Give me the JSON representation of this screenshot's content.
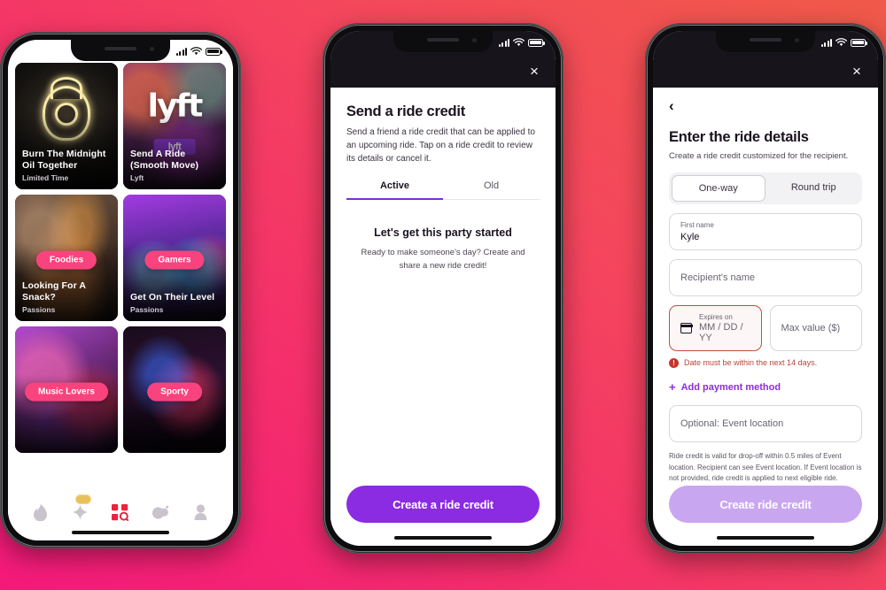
{
  "theme": {
    "bg_gradient_from": "#F3197A",
    "bg_gradient_to": "#F05A48",
    "accent_purple": "#8B2BE2",
    "accent_purple_disabled": "#C9A6F0",
    "accent_pink": "#F9437E",
    "error_red": "#C8332B"
  },
  "phone_left": {
    "name": "discover-grid-screen",
    "status_bar": {
      "signal": "signal-bars-icon",
      "wifi": "wifi-icon",
      "battery": "battery-icon"
    },
    "cards": [
      {
        "title": "Burn The Midnight Oil Together",
        "subtitle": "Limited Time",
        "badge": "",
        "art": "owl"
      },
      {
        "title": "Send A Ride (Smooth Move)",
        "subtitle": "Lyft",
        "badge": "",
        "art": "lyft"
      },
      {
        "title": "Looking For A Snack?",
        "subtitle": "Passions",
        "badge": "Foodies",
        "art": "food"
      },
      {
        "title": "Get On Their Level",
        "subtitle": "Passions",
        "badge": "Gamers",
        "art": "game"
      },
      {
        "title": "",
        "subtitle": "",
        "badge": "Music Lovers",
        "art": "music"
      },
      {
        "title": "",
        "subtitle": "",
        "badge": "Sporty",
        "art": "sport"
      }
    ],
    "tabs": [
      {
        "name": "flame-icon",
        "label": "Home",
        "active": false,
        "badge": false
      },
      {
        "name": "sparkle-icon",
        "label": "Top Picks",
        "active": false,
        "badge": true
      },
      {
        "name": "explore-grid-icon",
        "label": "Explore",
        "active": true,
        "badge": false
      },
      {
        "name": "chat-icon",
        "label": "Messages",
        "active": false,
        "badge": false
      },
      {
        "name": "profile-icon",
        "label": "Profile",
        "active": false,
        "badge": false
      }
    ]
  },
  "phone_mid": {
    "name": "send-ride-credit-sheet",
    "close_label": "×",
    "title": "Send a ride credit",
    "description": "Send a friend a ride credit that can be applied to an upcoming ride. Tap on a ride credit to review its details or cancel it.",
    "tabs": [
      {
        "label": "Active",
        "active": true
      },
      {
        "label": "Old",
        "active": false
      }
    ],
    "empty_state": {
      "heading": "Let's get this party started",
      "body": "Ready to make someone's day? Create and share a new ride credit!"
    },
    "cta_label": "Create a ride credit"
  },
  "phone_right": {
    "name": "ride-details-form-sheet",
    "close_label": "×",
    "back_label": "‹",
    "title": "Enter the ride details",
    "subtitle": "Create a ride credit customized for the recipient.",
    "segmented": [
      {
        "label": "One-way",
        "selected": true
      },
      {
        "label": "Round trip",
        "selected": false
      }
    ],
    "fields": {
      "first_name": {
        "label": "First name",
        "value": "Kyle"
      },
      "recipient_name": {
        "placeholder": "Recipient's name",
        "value": ""
      },
      "expires_on": {
        "label": "Expires on",
        "placeholder": "MM / DD / YY",
        "icon": "calendar-icon",
        "error": true
      },
      "max_value": {
        "placeholder": "Max value ($)",
        "value": ""
      },
      "event_location": {
        "placeholder": "Optional: Event location",
        "value": ""
      }
    },
    "error_message": "Date must be within the next 14 days.",
    "add_payment_label": "Add payment method",
    "add_payment_plus": "+",
    "helper_text": "Ride credit is valid for drop-off within 0.5 miles of Event location. Recipient can see Event location. If Event location is not provided, ride credit is applied to next eligible ride.",
    "cta_label": "Create ride credit",
    "cta_disabled": true
  }
}
